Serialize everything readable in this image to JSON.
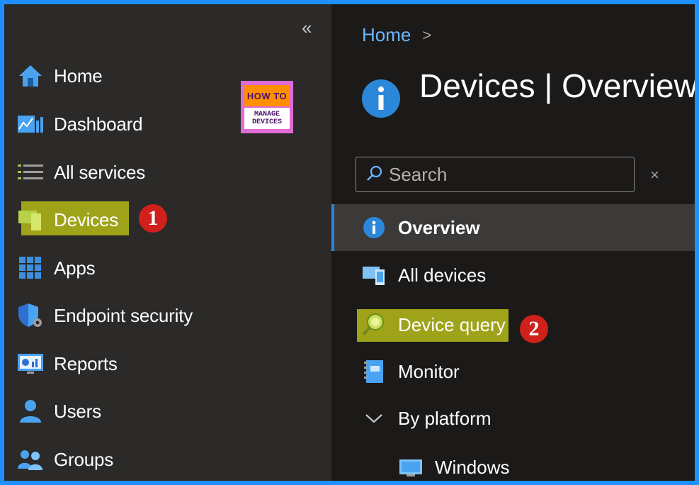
{
  "sidebar": {
    "collapse_glyph": "«",
    "items": [
      {
        "label": "Home",
        "icon": "home-icon"
      },
      {
        "label": "Dashboard",
        "icon": "dashboard-icon"
      },
      {
        "label": "All services",
        "icon": "list-icon"
      },
      {
        "label": "Devices",
        "icon": "devices-icon",
        "highlighted": true
      },
      {
        "label": "Apps",
        "icon": "apps-grid-icon"
      },
      {
        "label": "Endpoint security",
        "icon": "shield-gear-icon"
      },
      {
        "label": "Reports",
        "icon": "reports-icon"
      },
      {
        "label": "Users",
        "icon": "user-icon"
      },
      {
        "label": "Groups",
        "icon": "groups-icon"
      }
    ]
  },
  "logo": {
    "line1": "HOW TO",
    "line2": "MANAGE",
    "line3": "DEVICES"
  },
  "annotations": {
    "step1": "1",
    "step2": "2"
  },
  "breadcrumb": {
    "home": "Home",
    "separator": ">"
  },
  "page": {
    "title": "Devices | Overview"
  },
  "search": {
    "placeholder": "Search",
    "clear_glyph": "×"
  },
  "menu": {
    "items": [
      {
        "label": "Overview",
        "icon": "info-icon",
        "selected": true
      },
      {
        "label": "All devices",
        "icon": "all-devices-icon"
      },
      {
        "label": "Device query",
        "icon": "device-query-icon",
        "highlighted": true
      },
      {
        "label": "Monitor",
        "icon": "monitor-book-icon"
      },
      {
        "label": "By platform",
        "icon": "chevron-down-icon",
        "expanded": true
      },
      {
        "label": "Windows",
        "icon": "windows-device-icon"
      }
    ]
  },
  "colors": {
    "accent_blue": "#2b88d8",
    "highlight_yellow": "#9fa31a",
    "annotation_red": "#d0201c"
  }
}
